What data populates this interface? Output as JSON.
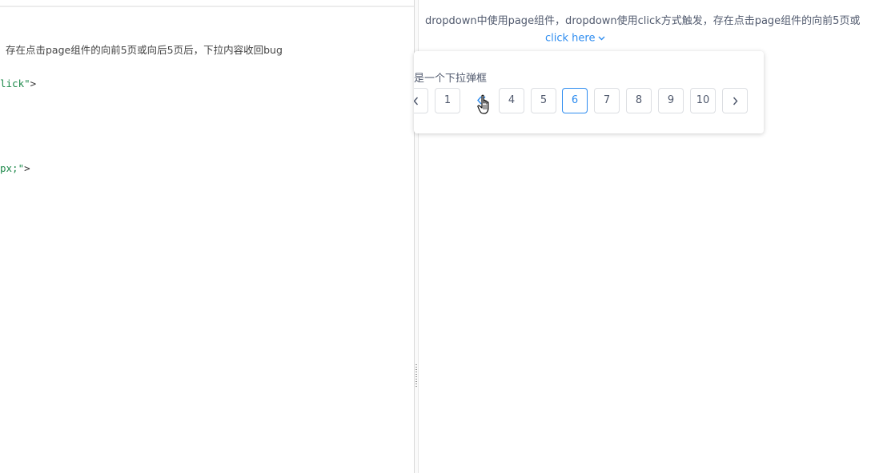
{
  "editor": {
    "comment_line": "存在点击page组件的向前5页或向后5页后，下拉内容收回bug",
    "line2_str": "lick\"",
    "line2_punct": ">",
    "line3_str": "px;\"",
    "line3_punct": ">"
  },
  "preview": {
    "description": "dropdown中使用page组件，dropdown使用click方式触发，存在点击page组件的向前5页或",
    "trigger_label": "click here",
    "trigger_icon": "chevron-down-icon"
  },
  "dropdown": {
    "text": "是一个下拉弹框",
    "pagination": {
      "prev_icon": "chevron-left-icon",
      "next_icon": "chevron-right-icon",
      "jump_prev_icon": "double-chevron-left-icon",
      "first_page": "1",
      "pages": [
        "4",
        "5",
        "6",
        "7",
        "8",
        "9",
        "10"
      ],
      "current_page": "6"
    }
  },
  "colors": {
    "accent": "#2d8cf0",
    "text": "#515a6e",
    "border": "#dcdee2",
    "code_string": "#1f8a4c"
  }
}
